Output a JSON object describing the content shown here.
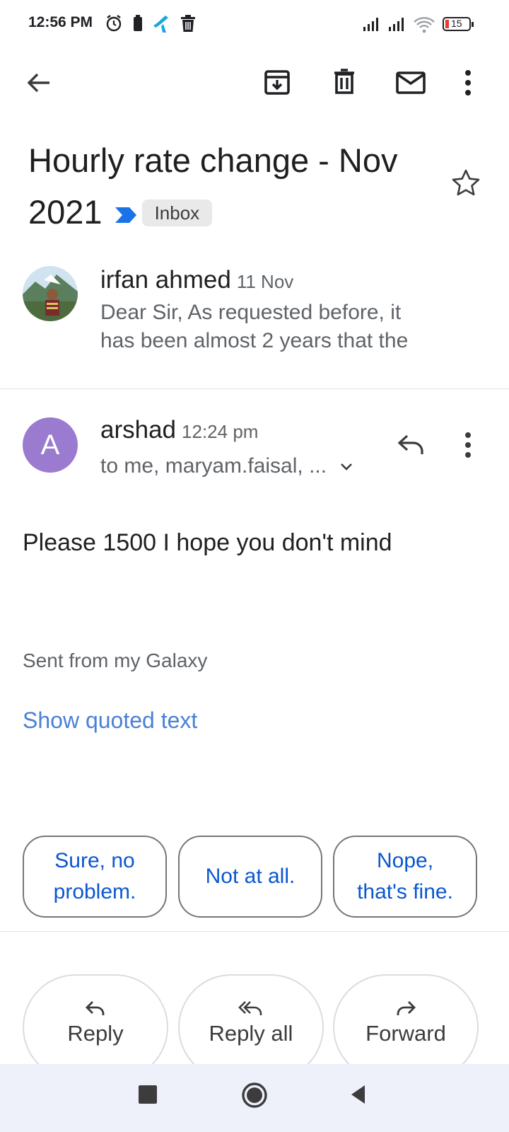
{
  "status_bar": {
    "time": "12:56 PM",
    "battery": "15"
  },
  "toolbar": {
    "back": "back-arrow-icon",
    "archive": "archive-icon",
    "delete": "delete-icon",
    "mark_unread": "mail-icon",
    "more": "more-vert-icon"
  },
  "subject": {
    "text": "Hourly rate change - Nov 2021",
    "label": "Inbox"
  },
  "messages": [
    {
      "sender": "irfan ahmed",
      "date": "11 Nov",
      "snippet_line1": "Dear Sir, As requested before, it",
      "snippet_line2": "has been almost 2 years that the"
    },
    {
      "sender": "arshad",
      "avatar_letter": "A",
      "avatar_color": "#9b7bd0",
      "time": "12:24 pm",
      "recipients": "to me, maryam.faisal, ...",
      "body": "Please 1500 I hope you don't mind",
      "signature": "Sent from my Galaxy",
      "show_quoted": "Show quoted text"
    }
  ],
  "smart_replies": [
    {
      "line1": "Sure, no",
      "line2": "problem."
    },
    {
      "line1": "Not at all.",
      "line2": ""
    },
    {
      "line1": "Nope,",
      "line2": "that's fine."
    }
  ],
  "actions": {
    "reply": "Reply",
    "reply_all": "Reply all",
    "forward": "Forward"
  },
  "colors": {
    "accent": "#0b57d0",
    "link": "#4a80d8",
    "important": "#1a73e8"
  }
}
